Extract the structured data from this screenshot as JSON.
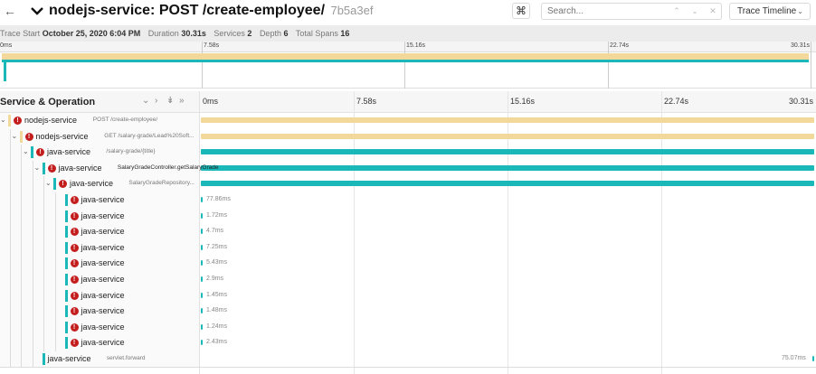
{
  "header": {
    "back_icon": "arrow-left-icon",
    "title": "nodejs-service: POST /create-employee/",
    "trace_id": "7b5a3ef",
    "cmd_symbol": "⌘",
    "search_placeholder": "Search...",
    "timeline_label": "Trace Timeline"
  },
  "summary": {
    "trace_start_label": "Trace Start",
    "trace_start": "October 25, 2020 6:04 PM",
    "duration_label": "Duration",
    "duration": "30.31s",
    "services_label": "Services",
    "services": "2",
    "depth_label": "Depth",
    "depth": "6",
    "total_spans_label": "Total Spans",
    "total_spans": "16"
  },
  "minimap_ticks": [
    "0ms",
    "7.58s",
    "15.16s",
    "22.74s",
    "30.31s"
  ],
  "column_header": {
    "service_operation": "Service & Operation",
    "ticks": [
      "0ms",
      "7.58s",
      "15.16s",
      "22.74s",
      "30.31s"
    ]
  },
  "colors": {
    "nodejs": "#f2d89b",
    "java": "#1ab8b8",
    "error": "#c41d1d"
  },
  "rows": [
    {
      "service": "nodejs-service",
      "operation": "POST /create-employee/",
      "color": "nodejs",
      "depth": 0,
      "toggle": "expanded",
      "error": true,
      "start_frac": 0.0,
      "end_frac": 1.0,
      "duration": ""
    },
    {
      "service": "nodejs-service",
      "operation": "GET /salary-grade/Lead%20Soft...",
      "color": "nodejs",
      "depth": 1,
      "toggle": "expanded",
      "error": true,
      "start_frac": 0.0,
      "end_frac": 1.0,
      "duration": ""
    },
    {
      "service": "java-service",
      "operation": "/salary-grade/{title}",
      "color": "java",
      "depth": 2,
      "toggle": "expanded",
      "error": true,
      "start_frac": 0.0,
      "end_frac": 1.0,
      "duration": ""
    },
    {
      "service": "java-service",
      "operation": "SalaryGradeController.getSalaryGrade",
      "color": "java",
      "depth": 3,
      "toggle": "expanded",
      "error": true,
      "start_frac": 0.0,
      "end_frac": 1.0,
      "duration": "",
      "highlight_service": true
    },
    {
      "service": "java-service",
      "operation": "SalaryGradeRepository...",
      "color": "java",
      "depth": 4,
      "toggle": "expanded",
      "error": true,
      "start_frac": 0.0,
      "end_frac": 1.0,
      "duration": ""
    },
    {
      "service": "java-service",
      "operation": "",
      "color": "java",
      "depth": 5,
      "toggle": "none",
      "error": true,
      "start_frac": 0.0,
      "end_frac": 0.003,
      "duration": "77.86ms"
    },
    {
      "service": "java-service",
      "operation": "",
      "color": "java",
      "depth": 5,
      "toggle": "none",
      "error": true,
      "start_frac": 0.0,
      "end_frac": 0.002,
      "duration": "1.72ms"
    },
    {
      "service": "java-service",
      "operation": "",
      "color": "java",
      "depth": 5,
      "toggle": "none",
      "error": true,
      "start_frac": 0.0,
      "end_frac": 0.002,
      "duration": "4.7ms"
    },
    {
      "service": "java-service",
      "operation": "",
      "color": "java",
      "depth": 5,
      "toggle": "none",
      "error": true,
      "start_frac": 0.0,
      "end_frac": 0.002,
      "duration": "7.25ms"
    },
    {
      "service": "java-service",
      "operation": "",
      "color": "java",
      "depth": 5,
      "toggle": "none",
      "error": true,
      "start_frac": 0.0,
      "end_frac": 0.002,
      "duration": "5.43ms"
    },
    {
      "service": "java-service",
      "operation": "",
      "color": "java",
      "depth": 5,
      "toggle": "none",
      "error": true,
      "start_frac": 0.0,
      "end_frac": 0.002,
      "duration": "2.9ms"
    },
    {
      "service": "java-service",
      "operation": "",
      "color": "java",
      "depth": 5,
      "toggle": "none",
      "error": true,
      "start_frac": 0.0,
      "end_frac": 0.002,
      "duration": "1.45ms"
    },
    {
      "service": "java-service",
      "operation": "",
      "color": "java",
      "depth": 5,
      "toggle": "none",
      "error": true,
      "start_frac": 0.0,
      "end_frac": 0.002,
      "duration": "1.48ms"
    },
    {
      "service": "java-service",
      "operation": "",
      "color": "java",
      "depth": 5,
      "toggle": "none",
      "error": true,
      "start_frac": 0.0,
      "end_frac": 0.002,
      "duration": "1.24ms"
    },
    {
      "service": "java-service",
      "operation": "",
      "color": "java",
      "depth": 5,
      "toggle": "none",
      "error": true,
      "start_frac": 0.0,
      "end_frac": 0.002,
      "duration": "2.43ms"
    },
    {
      "service": "java-service",
      "operation": "servlet.forward",
      "color": "java",
      "depth": 3,
      "toggle": "none",
      "error": false,
      "start_frac": 0.997,
      "end_frac": 1.0,
      "duration": "75.07ms",
      "duration_side": "left"
    }
  ]
}
